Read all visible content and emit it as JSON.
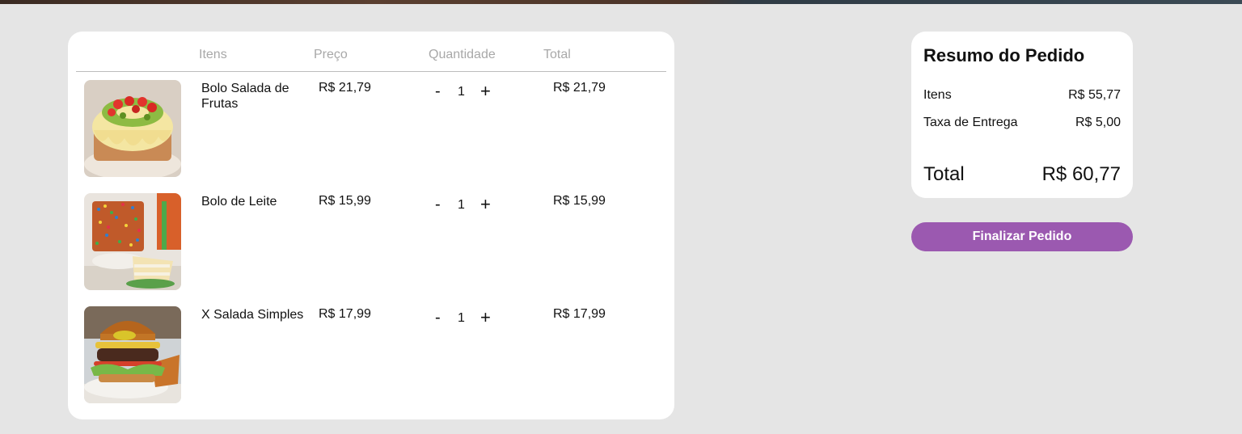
{
  "cart": {
    "headers": {
      "items": "Itens",
      "price": "Preço",
      "quantity": "Quantidade",
      "total": "Total"
    },
    "rows": [
      {
        "name": "Bolo Salada de Frutas",
        "price": "R$ 21,79",
        "quantity": "1",
        "total": "R$ 21,79",
        "minus": "-",
        "plus": "+",
        "image": "fruit-cake-photo"
      },
      {
        "name": "Bolo de Leite",
        "price": "R$ 15,99",
        "quantity": "1",
        "total": "R$ 15,99",
        "minus": "-",
        "plus": "+",
        "image": "sprinkle-cake-photo"
      },
      {
        "name": "X Salada Simples",
        "price": "R$ 17,99",
        "quantity": "1",
        "total": "R$ 17,99",
        "minus": "-",
        "plus": "+",
        "image": "burger-photo"
      }
    ]
  },
  "summary": {
    "title": "Resumo do Pedido",
    "items_label": "Itens",
    "items_value": "R$ 55,77",
    "delivery_label": "Taxa de Entrega",
    "delivery_value": "R$ 5,00",
    "total_label": "Total",
    "total_value": "R$ 60,77"
  },
  "actions": {
    "finalize_label": "Finalizar Pedido"
  },
  "colors": {
    "page_background": "#e5e5e5",
    "card_background": "#ffffff",
    "accent": "#9b59b0",
    "header_text": "#a8a8a8"
  }
}
